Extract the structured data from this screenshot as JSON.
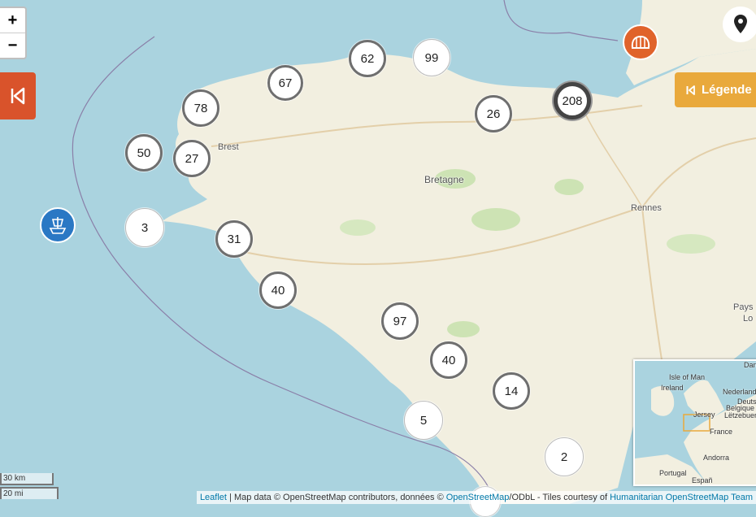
{
  "map": {
    "place_labels": {
      "brest": "Brest",
      "bretagne": "Bretagne",
      "rennes": "Rennes",
      "pays": "Pays",
      "lo": "Lo"
    },
    "clusters": [
      {
        "count": "62"
      },
      {
        "count": "99"
      },
      {
        "count": "67"
      },
      {
        "count": "78"
      },
      {
        "count": "26"
      },
      {
        "count": "208"
      },
      {
        "count": "50"
      },
      {
        "count": "27"
      },
      {
        "count": "3"
      },
      {
        "count": "31"
      },
      {
        "count": "40"
      },
      {
        "count": "97"
      },
      {
        "count": "40"
      },
      {
        "count": "14"
      },
      {
        "count": "5"
      },
      {
        "count": "2"
      }
    ]
  },
  "controls": {
    "zoom_in": "+",
    "zoom_out": "−",
    "legend_label": "Légende",
    "colors": {
      "sidebar": "#d9532b",
      "legend": "#e9a93c",
      "marker_orange": "#e0632b",
      "marker_blue": "#2a78c4"
    }
  },
  "minimap": {
    "labels": {
      "isle_of_man": "Isle of Man",
      "ireland": "Ireland",
      "nederland": "Nederland",
      "deutschland": "Deuts",
      "belgique": "Belgique",
      "letzebuerg": "Lëtzebuerg",
      "jersey": "Jersey",
      "france": "France",
      "andorra": "Andorra",
      "portugal": "Portugal",
      "espana": "Españ",
      "dan": "Dan"
    }
  },
  "scale": {
    "metric": "30 km",
    "imperial": "20 mi"
  },
  "attribution": {
    "leaflet": "Leaflet",
    "sep": " | Map data © OpenStreetMap contributors, données © ",
    "osm": "OpenStreetMap",
    "odbl": "/ODbL - Tiles courtesy of ",
    "hot": "Humanitarian OpenStreetMap Team"
  }
}
